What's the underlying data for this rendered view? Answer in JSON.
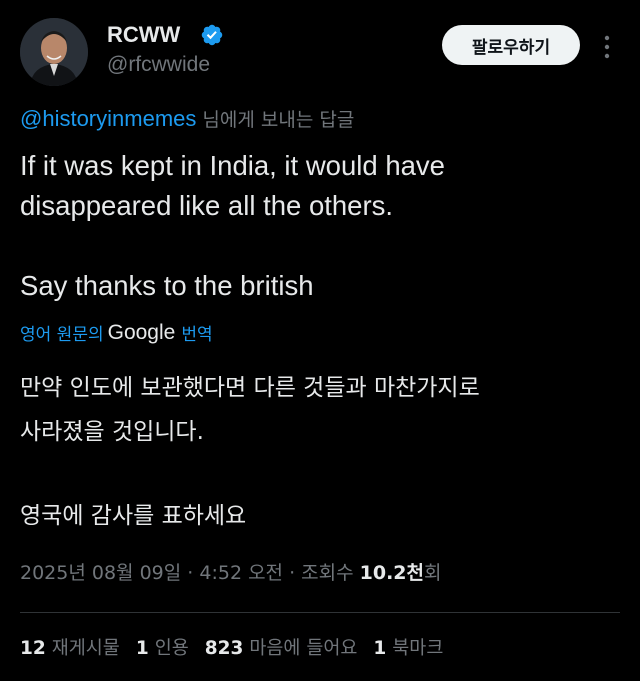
{
  "author": {
    "display_name": "RCWW",
    "handle": "@rfcwwide",
    "verified": true,
    "avatar_icon": "profile-photo"
  },
  "follow_button": {
    "label": "팔로우하기"
  },
  "more_button": {
    "icon": "more-vertical-icon"
  },
  "reply_to": {
    "mention": "@historyinmemes",
    "suffix": " 님에게 보내는 답글"
  },
  "tweet": {
    "paragraphs": [
      "If it was kept in India, it would have\ndisappeared like all the others.",
      "Say thanks to the british"
    ]
  },
  "translate": {
    "prefix": "영어 원문의",
    "google": "Google",
    "suffix": "번역"
  },
  "translation": {
    "paragraphs": [
      "만약 인도에 보관했다면 다른 것들과 마찬가지로\n사라졌을 것입니다.",
      "영국에 감사를 표하세요"
    ]
  },
  "meta": {
    "date": "2025년 08월 09일",
    "separator": " · ",
    "time": "4:52 오전",
    "views_label": "조회수 ",
    "views_count": "10.2천",
    "views_suffix": "회"
  },
  "stats": {
    "reposts": {
      "count": "12",
      "label": "재게시물"
    },
    "quotes": {
      "count": "1",
      "label": "인용"
    },
    "likes": {
      "count": "823",
      "label": "마음에 들어요"
    },
    "bookmarks": {
      "count": "1",
      "label": "북마크"
    }
  },
  "colors": {
    "background": "#000000",
    "text": "#e7e9ea",
    "secondary": "#71767b",
    "accent": "#1d9bf0"
  }
}
